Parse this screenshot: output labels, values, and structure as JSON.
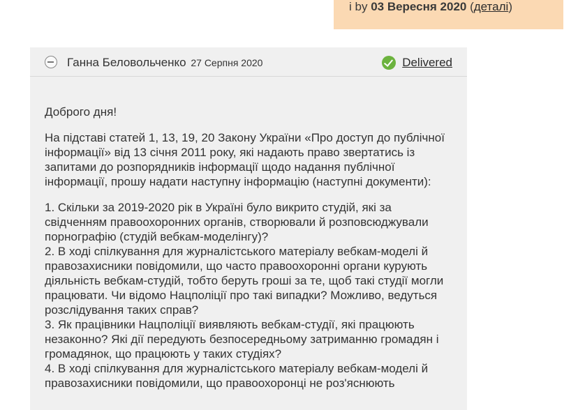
{
  "notice": {
    "prefix": "і by ",
    "date": "03 Вересня 2020",
    "open_paren": " (",
    "link": "деталі",
    "close_paren": ")"
  },
  "message": {
    "author": "Ганна Беловольченко",
    "date": "27 Серпня 2020",
    "status": "Delivered",
    "greeting": "Доброго дня!",
    "intro": "На підставі статей 1, 13, 19, 20 Закону України «Про доступ до публічної інформації» від 13 січня 2011 року, які надають право звертатись із запитами до розпорядників інформації щодо надання публічної інформації, прошу надати наступну інформацію (наступні документи):",
    "questions": [
      "1. Скільки за 2019-2020 рік в Україні було викрито студій, які за свідченням правоохоронних органів, створювали й розповсюджували порнографію (студій вебкам-моделінгу)?",
      "2. В ході спілкування для журналістського матеріалу вебкам-моделі й правозахисники повідомили, що часто правоохоронні органи курують діяльність вебкам-студій, тобто беруть гроші за те, щоб такі студії могли працювати. Чи відомо Нацполіції про такі випадки? Можливо, ведуться розслідування таких справ?",
      "3. Як працівники Нацполіції виявляють вебкам-студії, які працюють незаконно? Які дії передують безпосередньому затриманню громадян і громадянок, що працюють у таких студіях?",
      "4. В ході спілкування для журналістського матеріалу вебкам-моделі й правозахисники повідомили, що правоохоронці не роз'яснюють"
    ]
  }
}
